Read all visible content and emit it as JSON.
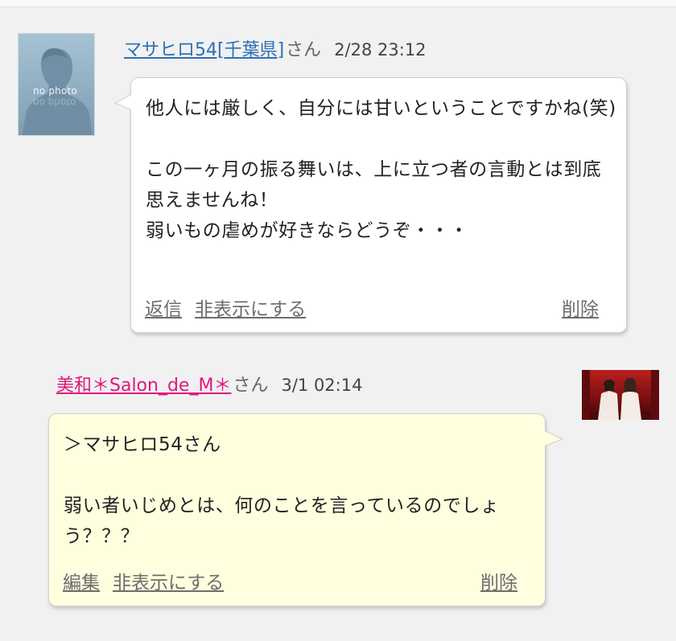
{
  "comments": [
    {
      "avatar": {
        "label": "no photo",
        "icon": "no-photo-silhouette"
      },
      "user_link": "マサヒロ54[千葉県]",
      "suffix": "さん",
      "date": "2/28 23:12",
      "body": "他人には厳しく、自分には甘いということですかね(笑)\n\nこの一ヶ月の振る舞いは、上に立つ者の言動とは到底思えませんね！\n弱いもの虐めが好きならどうぞ・・・",
      "actions": [
        "返信",
        "非表示にする"
      ],
      "delete_label": "削除",
      "link_color": "#2e6fb4",
      "bubble_color": "#ffffff"
    },
    {
      "avatar": {
        "icon": "user-photo-two-women-red"
      },
      "user_link": "美和＊Salon_de_M＊",
      "suffix": "さん",
      "date": "3/1 02:14",
      "body": "＞マサヒロ54さん\n\n弱い者いじめとは、何のことを言っているのでしょう？？？",
      "actions": [
        "編集",
        "非表示にする"
      ],
      "delete_label": "削除",
      "link_color": "#e0197d",
      "bubble_color": "#ffffdf"
    }
  ]
}
